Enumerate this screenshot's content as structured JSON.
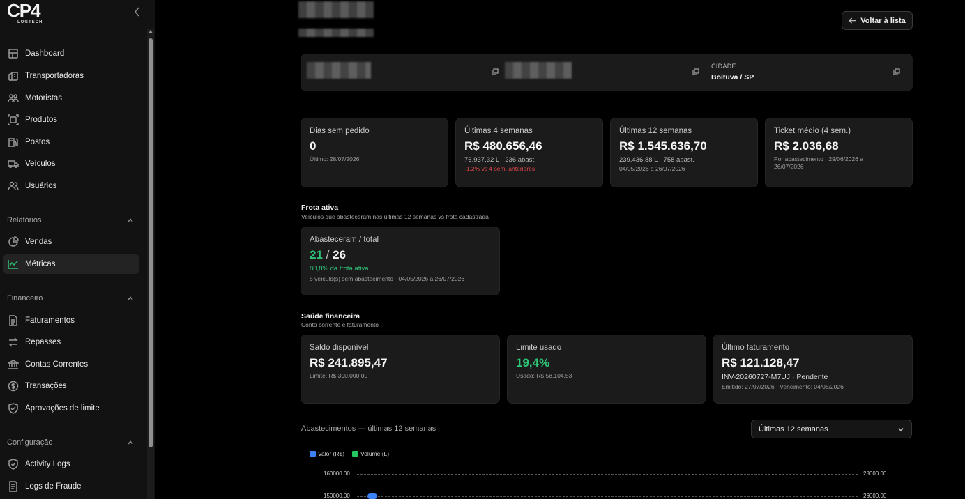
{
  "logo": {
    "main": "CP4",
    "sub": "LOGTECH"
  },
  "sidebar": {
    "items": [
      {
        "label": "Dashboard",
        "icon": "dashboard-icon"
      },
      {
        "label": "Transportadoras",
        "icon": "building-icon"
      },
      {
        "label": "Motoristas",
        "icon": "users-icon"
      },
      {
        "label": "Produtos",
        "icon": "box-icon"
      },
      {
        "label": "Postos",
        "icon": "fuel-icon"
      },
      {
        "label": "Veículos",
        "icon": "truck-icon"
      },
      {
        "label": "Usuários",
        "icon": "user-group-icon"
      }
    ],
    "sections": [
      {
        "title": "Relatórios",
        "items": [
          {
            "label": "Vendas",
            "icon": "chart-pie-icon"
          },
          {
            "label": "Métricas",
            "icon": "line-chart-icon",
            "active": true
          }
        ]
      },
      {
        "title": "Financeiro",
        "items": [
          {
            "label": "Faturamentos",
            "icon": "document-icon"
          },
          {
            "label": "Repasses",
            "icon": "transfer-icon"
          },
          {
            "label": "Contas Correntes",
            "icon": "bank-icon"
          },
          {
            "label": "Transações",
            "icon": "dollar-icon"
          },
          {
            "label": "Aprovações de limite",
            "icon": "shield-icon"
          }
        ]
      },
      {
        "title": "Configuração",
        "items": [
          {
            "label": "Activity Logs",
            "icon": "shield-check-icon"
          },
          {
            "label": "Logs de Fraude",
            "icon": "file-alert-icon"
          }
        ]
      }
    ]
  },
  "header": {
    "back_button": "Voltar à lista"
  },
  "info": {
    "city_label": "CIDADE",
    "city_value": "Boituva / SP"
  },
  "kpis": [
    {
      "title": "Dias sem pedido",
      "value": "0",
      "sub": "Último: 28/07/2026"
    },
    {
      "title": "Últimas 4 semanas",
      "value": "R$ 480.656,46",
      "sub": "76.937,32 L · 236 abast.",
      "note": "-1,2% vs 4 sem. anteriores"
    },
    {
      "title": "Últimas 12 semanas",
      "value": "R$ 1.545.636,70",
      "sub": "239.436,88 L · 758 abast.",
      "note": "04/05/2026 a 26/07/2026"
    },
    {
      "title": "Ticket médio (4 sem.)",
      "value": "R$ 2.036,68",
      "note": "Por abastecimento · 29/06/2026 a 26/07/2026"
    }
  ],
  "fleet": {
    "title": "Frota ativa",
    "subtitle": "Veículos que abasteceram nas últimas 12 semanas vs frota cadastrada",
    "card_title": "Abasteceram / total",
    "active": "21",
    "separator": "/",
    "total": "26",
    "percent_text": "80,8% da frota ativa",
    "note": "5 veículo(s) sem abastecimento · 04/05/2026 a 26/07/2026"
  },
  "finance": {
    "title": "Saúde financeira",
    "subtitle": "Conta corrente e faturamento",
    "cards": [
      {
        "title": "Saldo disponível",
        "value": "R$ 241.895,47",
        "note": "Limite: R$ 300.000,00"
      },
      {
        "title": "Limite usado",
        "value": "19,4%",
        "note": "Usado: R$ 58.104,53"
      },
      {
        "title": "Último faturamento",
        "value": "R$ 121.128,47",
        "sub": "INV-20260727-M7UJ · Pendente",
        "note": "Emitido: 27/07/2026 · Vencimento: 04/08/2026"
      }
    ]
  },
  "chart": {
    "title": "Abastecimentos — últimas 12 semanas",
    "range_select": "Últimas 12 semanas",
    "legend": [
      {
        "label": "Valor (R$)",
        "color": "#3b82f6"
      },
      {
        "label": "Volume (L)",
        "color": "#22c55e"
      }
    ],
    "left_ticks": [
      "160000.00",
      "150000.00"
    ],
    "right_ticks": [
      "28000.00",
      "26000.00"
    ]
  },
  "chart_data": {
    "type": "line",
    "title": "Abastecimentos — últimas 12 semanas",
    "series": [
      {
        "name": "Valor (R$)",
        "values": [
          150000
        ]
      },
      {
        "name": "Volume (L)",
        "values": []
      }
    ],
    "y_left_ticks": [
      160000,
      150000
    ],
    "y_right_ticks": [
      28000,
      26000
    ],
    "legend_position": "top-left",
    "grid": true
  }
}
